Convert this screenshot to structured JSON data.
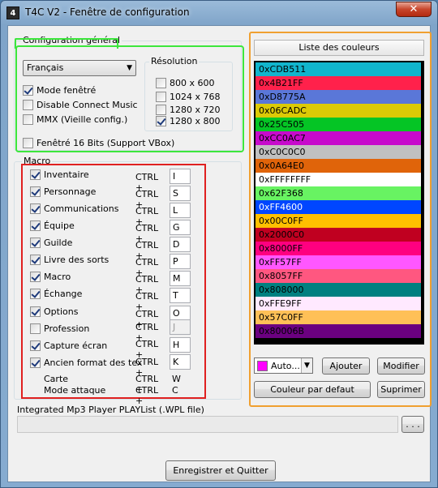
{
  "window": {
    "title": "T4C V2 - Fenêtre de configuration",
    "icon_text": "4",
    "close_label": "✕"
  },
  "config": {
    "title": "Configuration général",
    "language": "Français",
    "options": [
      {
        "label": "Mode fenêtré",
        "checked": true
      },
      {
        "label": "Disable Connect Music",
        "checked": false
      },
      {
        "label": "MMX (Vieille config.)",
        "checked": false
      }
    ],
    "fenetre16": {
      "label": "Fenêtré 16 Bits (Support VBox)",
      "checked": false
    },
    "resolution": {
      "title": "Résolution",
      "items": [
        {
          "label": "800 x 600",
          "checked": false
        },
        {
          "label": "1024 x 768",
          "checked": false
        },
        {
          "label": "1280 x 720",
          "checked": false
        },
        {
          "label": "1280 x 800",
          "checked": true
        }
      ]
    }
  },
  "macro": {
    "title": "Macro",
    "ctrl_label": "CTRL +",
    "items": [
      {
        "label": "Inventaire",
        "checked": true,
        "key": "I",
        "disabled": false
      },
      {
        "label": "Personnage",
        "checked": true,
        "key": "S",
        "disabled": false
      },
      {
        "label": "Communications",
        "checked": true,
        "key": "L",
        "disabled": false
      },
      {
        "label": "Équipe",
        "checked": true,
        "key": "G",
        "disabled": false
      },
      {
        "label": "Guilde",
        "checked": true,
        "key": "D",
        "disabled": false
      },
      {
        "label": "Livre des sorts",
        "checked": true,
        "key": "P",
        "disabled": false
      },
      {
        "label": "Macro",
        "checked": true,
        "key": "M",
        "disabled": false
      },
      {
        "label": "Échange",
        "checked": true,
        "key": "T",
        "disabled": false
      },
      {
        "label": "Options",
        "checked": true,
        "key": "O",
        "disabled": false
      },
      {
        "label": "Profession",
        "checked": false,
        "key": "J",
        "disabled": true
      },
      {
        "label": "Capture écran",
        "checked": true,
        "key": "H",
        "disabled": false
      },
      {
        "label": "Ancien format des tex",
        "checked": true,
        "key": "K",
        "disabled": false
      }
    ],
    "fixed": [
      {
        "label": "Carte",
        "ctrl": "CTRL +",
        "key": "W"
      },
      {
        "label": "Mode attaque",
        "ctrl": "CTRL +",
        "key": "C"
      }
    ]
  },
  "colors": {
    "title": "Liste des couleurs",
    "items": [
      {
        "label": "0xCDB511",
        "bg": "#11b5cd",
        "fg": "#000000"
      },
      {
        "label": "0x4B21FF",
        "bg": "#ff214b",
        "fg": "#000000"
      },
      {
        "label": "0xD8775A",
        "bg": "#5a77d8",
        "fg": "#000000"
      },
      {
        "label": "0x06CADC",
        "bg": "#dcca06",
        "fg": "#000000"
      },
      {
        "label": "0x25C505",
        "bg": "#05c525",
        "fg": "#000000"
      },
      {
        "label": "0xCC0AC7",
        "bg": "#c70acc",
        "fg": "#000000"
      },
      {
        "label": "0xC0C0C0",
        "bg": "#c0c0c0",
        "fg": "#000000"
      },
      {
        "label": "0x0A64E0",
        "bg": "#e0640a",
        "fg": "#000000"
      },
      {
        "label": "0xFFFFFFFF",
        "bg": "#ffffff",
        "fg": "#000000"
      },
      {
        "label": "0x62F368",
        "bg": "#68f362",
        "fg": "#000000"
      },
      {
        "label": "0xFF4600",
        "bg": "#0046ff",
        "fg": "#ffffff"
      },
      {
        "label": "0x00C0FF",
        "bg": "#ffc000",
        "fg": "#000000"
      },
      {
        "label": "0x2000C0",
        "bg": "#c00020",
        "fg": "#000000"
      },
      {
        "label": "0x8000FF",
        "bg": "#ff0080",
        "fg": "#000000"
      },
      {
        "label": "0xFF57FF",
        "bg": "#ff57ff",
        "fg": "#000000"
      },
      {
        "label": "0x8057FF",
        "bg": "#ff5780",
        "fg": "#000000"
      },
      {
        "label": "0x808000",
        "bg": "#008080",
        "fg": "#000000"
      },
      {
        "label": "0xFFE9FF",
        "bg": "#ffe9ff",
        "fg": "#000000"
      },
      {
        "label": "0x57C0FF",
        "bg": "#ffc057",
        "fg": "#000000"
      },
      {
        "label": "0x80006B",
        "bg": "#6b0080",
        "fg": "#000000"
      }
    ],
    "auto_label": "Auto...",
    "auto_swatch": "#ff00ff",
    "add": "Ajouter",
    "modify": "Modifier",
    "default": "Couleur par defaut",
    "delete": "Suprimer"
  },
  "mp3": {
    "label": "Integrated Mp3 Player PLAYList (.WPL file)",
    "value": "",
    "browse": ". . ."
  },
  "save": "Enregistrer et Quitter"
}
